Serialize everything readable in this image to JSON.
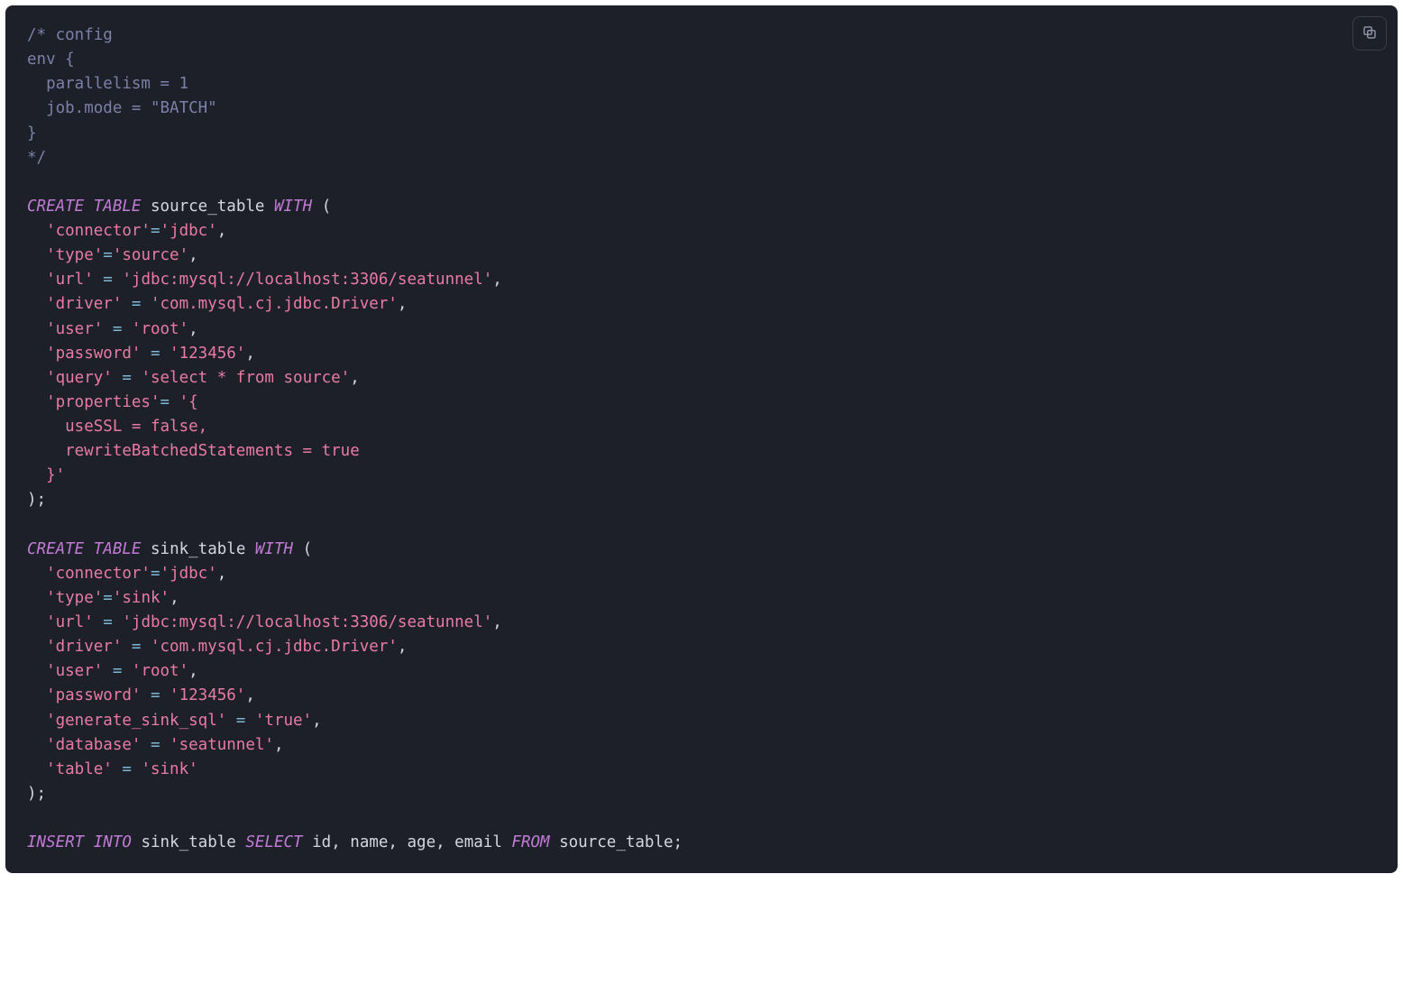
{
  "code": {
    "comment": {
      "open": "/* config",
      "env_open": "env {",
      "parallelism": "  parallelism = 1",
      "jobmode": "  job.mode = \"BATCH\"",
      "env_close": "}",
      "close": "*/"
    },
    "source": {
      "kw_create": "CREATE",
      "kw_table": "TABLE",
      "table_name": "source_table",
      "kw_with": "WITH",
      "open_paren": "(",
      "connector_k": "'connector'",
      "eq1": "=",
      "connector_v": "'jdbc'",
      "comma": ",",
      "type_k": "'type'",
      "type_v": "'source'",
      "url_k": "'url'",
      "url_v": "'jdbc:mysql://localhost:3306/seatunnel'",
      "driver_k": "'driver'",
      "driver_v": "'com.mysql.cj.jdbc.Driver'",
      "user_k": "'user'",
      "user_v": "'root'",
      "password_k": "'password'",
      "password_v": "'123456'",
      "query_k": "'query'",
      "query_v": "'select * from source'",
      "properties_k": "'properties'",
      "props_open": "'{",
      "props_line1": "    useSSL = false,",
      "props_line2": "    rewriteBatchedStatements = true",
      "props_close": "  }'",
      "close_paren": ");"
    },
    "sink": {
      "kw_create": "CREATE",
      "kw_table": "TABLE",
      "table_name": "sink_table",
      "kw_with": "WITH",
      "open_paren": "(",
      "connector_k": "'connector'",
      "connector_v": "'jdbc'",
      "type_k": "'type'",
      "type_v": "'sink'",
      "url_k": "'url'",
      "url_v": "'jdbc:mysql://localhost:3306/seatunnel'",
      "driver_k": "'driver'",
      "driver_v": "'com.mysql.cj.jdbc.Driver'",
      "user_k": "'user'",
      "user_v": "'root'",
      "password_k": "'password'",
      "password_v": "'123456'",
      "gensql_k": "'generate_sink_sql'",
      "gensql_v": "'true'",
      "database_k": "'database'",
      "database_v": "'seatunnel'",
      "table_k": "'table'",
      "table_v": "'sink'",
      "close_paren": ");"
    },
    "insert": {
      "kw_insert": "INSERT",
      "kw_into": "INTO",
      "sink_name": "sink_table",
      "kw_select": "SELECT",
      "cols": "id, name, age, email",
      "kw_from": "FROM",
      "source_name": "source_table;"
    }
  },
  "punct": {
    "eq": "=",
    "eq_sp": " = ",
    "comma": ",",
    "indent": "  "
  }
}
